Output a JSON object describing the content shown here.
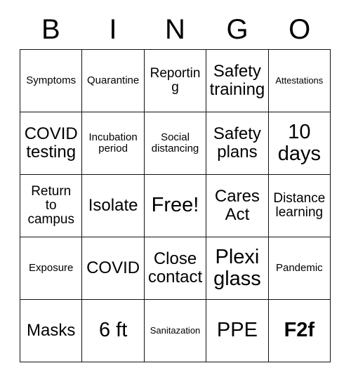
{
  "card": {
    "header": {
      "letters": [
        "B",
        "I",
        "N",
        "G",
        "O"
      ]
    },
    "rows": [
      {
        "cells": [
          {
            "text": "Symptoms",
            "size": "sm",
            "bold": false
          },
          {
            "text": "Quarantine",
            "size": "sm",
            "bold": false
          },
          {
            "text": "Reporting",
            "size": "md",
            "bold": false
          },
          {
            "text": "Safety\ntraining",
            "size": "lg",
            "bold": false
          },
          {
            "text": "Attestations",
            "size": "xs",
            "bold": false
          }
        ]
      },
      {
        "cells": [
          {
            "text": "COVID\ntesting",
            "size": "lg",
            "bold": false
          },
          {
            "text": "Incubation\nperiod",
            "size": "sm",
            "bold": false
          },
          {
            "text": "Social\ndistancing",
            "size": "sm",
            "bold": false
          },
          {
            "text": "Safety\nplans",
            "size": "lg",
            "bold": false
          },
          {
            "text": "10\ndays",
            "size": "xl",
            "bold": false
          }
        ]
      },
      {
        "cells": [
          {
            "text": "Return\nto\ncampus",
            "size": "md",
            "bold": false
          },
          {
            "text": "Isolate",
            "size": "lg",
            "bold": false
          },
          {
            "text": "Free!",
            "size": "xl",
            "bold": false
          },
          {
            "text": "Cares\nAct",
            "size": "lg",
            "bold": false
          },
          {
            "text": "Distance\nlearning",
            "size": "md",
            "bold": false
          }
        ]
      },
      {
        "cells": [
          {
            "text": "Exposure",
            "size": "sm",
            "bold": false
          },
          {
            "text": "COVID",
            "size": "lg",
            "bold": false
          },
          {
            "text": "Close\ncontact",
            "size": "lg",
            "bold": false
          },
          {
            "text": "Plexi\nglass",
            "size": "xl",
            "bold": false
          },
          {
            "text": "Pandemic",
            "size": "sm",
            "bold": false
          }
        ]
      },
      {
        "cells": [
          {
            "text": "Masks",
            "size": "lg",
            "bold": false
          },
          {
            "text": "6 ft",
            "size": "xl",
            "bold": false
          },
          {
            "text": "Sanitazation",
            "size": "xs",
            "bold": false
          },
          {
            "text": "PPE",
            "size": "xl",
            "bold": false
          },
          {
            "text": "F2f",
            "size": "xl",
            "bold": true
          }
        ]
      }
    ]
  },
  "colors": {
    "background": "#ffffff",
    "text": "#000000",
    "grid_line": "#111111"
  }
}
